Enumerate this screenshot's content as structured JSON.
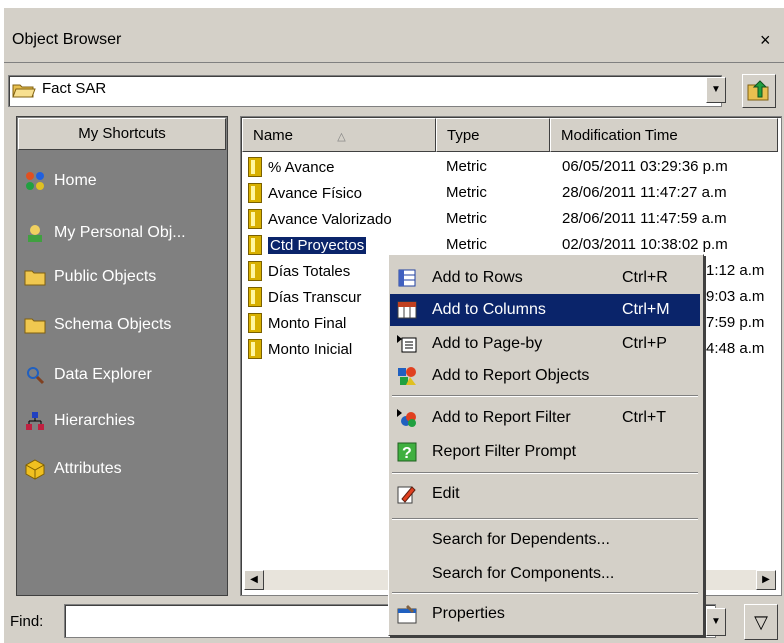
{
  "window": {
    "title": "Object Browser",
    "close_glyph": "×"
  },
  "location": {
    "current_folder": "Fact SAR",
    "folder_icon": "folder-open-icon",
    "up_icon": "folder-up-icon"
  },
  "shortcuts": {
    "header": "My Shortcuts",
    "items": [
      {
        "label": "Home",
        "icon": "home-icon"
      },
      {
        "label": "My Personal Obj...",
        "icon": "personal-objects-icon"
      },
      {
        "label": "Public Objects",
        "icon": "folder-icon"
      },
      {
        "label": "Schema Objects",
        "icon": "folder-icon"
      },
      {
        "label": "Data Explorer",
        "icon": "data-explorer-icon"
      },
      {
        "label": "Hierarchies",
        "icon": "hierarchies-icon"
      },
      {
        "label": "Attributes",
        "icon": "attributes-icon"
      }
    ]
  },
  "list": {
    "columns": [
      "Name",
      "Type",
      "Modification Time"
    ],
    "rows": [
      {
        "name": "% Avance",
        "type": "Metric",
        "time": "06/05/2011 03:29:36 p.m"
      },
      {
        "name": "Avance Físico",
        "type": "Metric",
        "time": "28/06/2011 11:47:27 a.m"
      },
      {
        "name": "Avance Valorizado",
        "type": "Metric",
        "time": "28/06/2011 11:47:59 a.m"
      },
      {
        "name": "Ctd Proyectos",
        "type": "Metric",
        "time": "02/03/2011 10:38:02 p.m"
      },
      {
        "name": "Días Totales",
        "type": "",
        "time": "1:12 a.m"
      },
      {
        "name": "Días Transcur",
        "type": "",
        "time": "9:03 a.m"
      },
      {
        "name": "Monto Final",
        "type": "",
        "time": "7:59 p.m"
      },
      {
        "name": "Monto Inicial",
        "type": "",
        "time": "4:48 a.m"
      }
    ]
  },
  "find": {
    "label": "Find:",
    "value": ""
  },
  "context_menu": {
    "items": [
      {
        "label": "Add to Rows",
        "shortcut": "Ctrl+R",
        "icon": "add-rows-icon"
      },
      {
        "label": "Add to Columns",
        "shortcut": "Ctrl+M",
        "icon": "add-columns-icon",
        "highlighted": true
      },
      {
        "label": "Add to Page-by",
        "shortcut": "Ctrl+P",
        "icon": "add-page-by-icon"
      },
      {
        "label": "Add to Report Objects",
        "shortcut": "",
        "icon": "report-objects-icon"
      },
      {
        "label": "Add to Report Filter",
        "shortcut": "Ctrl+T",
        "icon": "report-filter-icon"
      },
      {
        "label": "Report Filter Prompt",
        "shortcut": "",
        "icon": "filter-prompt-icon"
      },
      {
        "label": "Edit",
        "shortcut": "",
        "icon": "edit-icon"
      },
      {
        "label": "Search for Dependents...",
        "shortcut": "",
        "icon": ""
      },
      {
        "label": "Search for Components...",
        "shortcut": "",
        "icon": ""
      },
      {
        "label": "Properties",
        "shortcut": "",
        "icon": "properties-icon"
      }
    ]
  },
  "colors": {
    "selection": "#0a246a",
    "panel": "#808080",
    "face": "#d4d0c8"
  }
}
